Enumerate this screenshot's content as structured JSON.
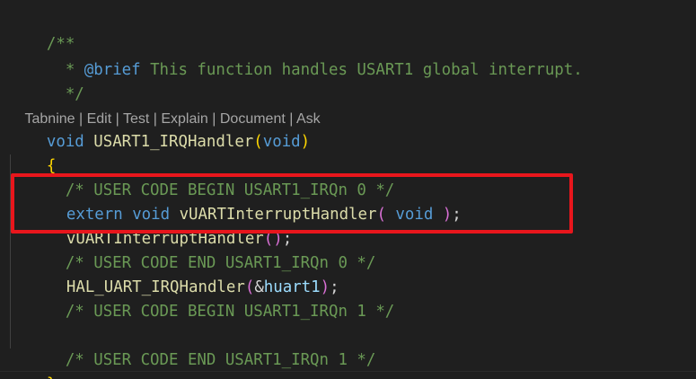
{
  "comment": {
    "open": "/**",
    "brief_prefix": "  * ",
    "brief_tag": "@brief",
    "brief_text": " This function handles USART1 global interrupt.",
    "close": "  */"
  },
  "codelens": {
    "items": [
      "Tabnine",
      "Edit",
      "Test",
      "Explain",
      "Document",
      "Ask"
    ],
    "separator": " | "
  },
  "code": {
    "signature": {
      "return_type": "void",
      "name": "USART1_IRQHandler",
      "param": "void"
    },
    "open_brace": "{",
    "close_brace": "}",
    "user_code_begin_0": "  /* USER CODE BEGIN USART1_IRQn 0 */",
    "extern_kw": "extern",
    "extern_type": "void",
    "handler_name": "vUARTInterruptHandler",
    "extern_param": " void ",
    "semicolon": ";",
    "call_name": "vUARTInterruptHandler",
    "user_code_end_0": "  /* USER CODE END USART1_IRQn 0 */",
    "hal_call": "HAL_UART_IRQHandler",
    "hal_arg_amp": "&",
    "hal_arg_var": "huart1",
    "user_code_begin_1": "  /* USER CODE BEGIN USART1_IRQn 1 */",
    "user_code_end_1": "  /* USER CODE END USART1_IRQn 1 */"
  },
  "colors": {
    "background": "#1f1f1f",
    "comment": "#6a9955",
    "keyword": "#569cd6",
    "function": "#dcdcaa",
    "variable": "#9cdcfe",
    "highlight_box": "#e8161c"
  }
}
